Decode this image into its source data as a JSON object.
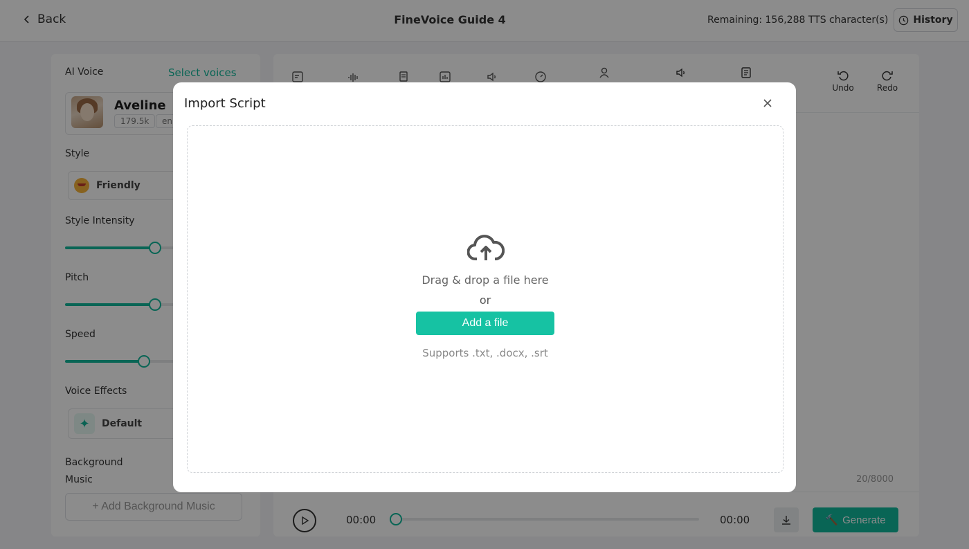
{
  "header": {
    "back_label": "Back",
    "title": "FineVoice Guide 4",
    "remaining": "Remaining: 156,288 TTS character(s)",
    "history_label": "History"
  },
  "left_panel": {
    "ai_voice_label": "AI Voice",
    "select_voices_label": "Select voices",
    "voice": {
      "name": "Aveline",
      "tags": [
        "179.5k",
        "en"
      ]
    },
    "style_label": "Style",
    "style_value": "Friendly",
    "style_intensity_label": "Style Intensity",
    "style_intensity_level": 0.65,
    "pitch_label": "Pitch",
    "pitch_level": 0.65,
    "speed_label": "Speed",
    "speed_level": 0.57,
    "voice_effects_label": "Voice Effects",
    "voice_effects_value": "Default",
    "background_music_label": "Background\nMusic",
    "add_background_music_label": "+ Add Background Music"
  },
  "editor": {
    "undo_label": "Undo",
    "redo_label": "Redo",
    "char_count": "20/8000",
    "player": {
      "current_time": "00:00",
      "total_time": "00:00",
      "progress": 0
    },
    "generate_label": "Generate"
  },
  "modal": {
    "title": "Import Script",
    "drag_text": "Drag & drop a file here",
    "or_text": "or",
    "add_file_label": "Add a file",
    "supports_text": "Supports .txt, .docx, .srt"
  },
  "colors": {
    "accent": "#11b89b",
    "overlay": "rgba(0,0,0,0.45)"
  },
  "icons": {
    "back": "chevron-left-icon",
    "history": "clock-icon",
    "close": "close-icon",
    "upload": "cloud-upload-icon",
    "undo": "undo-icon",
    "redo": "redo-icon",
    "play": "play-icon",
    "download": "download-icon"
  }
}
